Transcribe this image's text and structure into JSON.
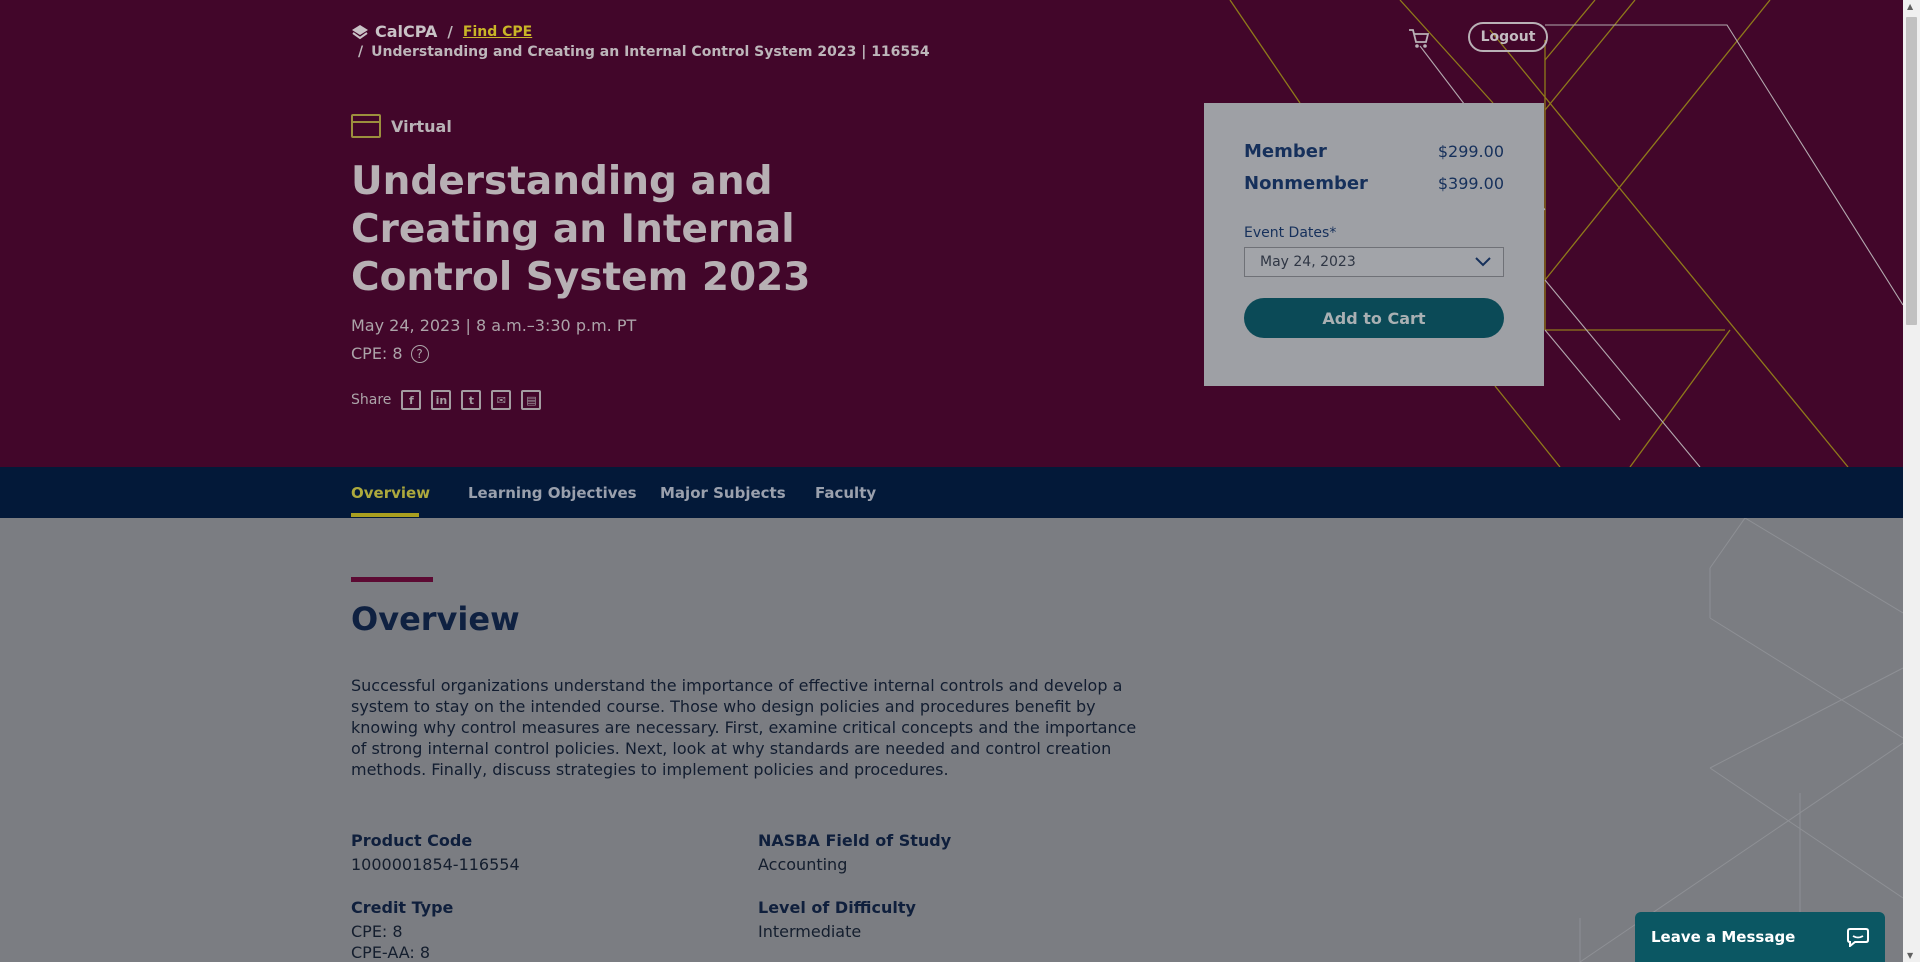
{
  "breadcrumb": {
    "brand": "CalCPA",
    "separator": "/",
    "find_cpe": "Find CPE",
    "current": "Understanding and Creating an Internal Control System 2023 | 116554"
  },
  "header": {
    "logout_label": "Logout",
    "cart_icon": "cart-icon"
  },
  "course": {
    "format": "Virtual",
    "title": "Understanding and Creating an Internal Control System 2023",
    "date_time": "May 24, 2023 | 8 a.m.–3:30 p.m. PT",
    "cpe": "CPE: 8",
    "share_label": "Share",
    "share_icons": [
      "facebook-icon",
      "linkedin-icon",
      "twitter-icon",
      "email-icon",
      "calendar-icon"
    ]
  },
  "pricing": {
    "member_label": "Member",
    "member_price": "$299.00",
    "nonmember_label": "Nonmember",
    "nonmember_price": "$399.00",
    "event_dates_label": "Event Dates*",
    "event_date_selected": "May 24, 2023",
    "add_to_cart_label": "Add to Cart"
  },
  "tabs": [
    {
      "label": "Overview",
      "active": true
    },
    {
      "label": "Learning Objectives",
      "active": false
    },
    {
      "label": "Major Subjects",
      "active": false
    },
    {
      "label": "Faculty",
      "active": false
    }
  ],
  "overview": {
    "heading": "Overview",
    "text": "Successful organizations understand the importance of effective internal controls and develop a system to stay on the intended course. Those who design policies and procedures benefit by knowing why control measures are necessary. First, examine critical concepts and the importance of strong internal control policies. Next, look at why standards are needed and control creation methods. Finally, discuss strategies to implement policies and procedures.",
    "facts": {
      "product_code_label": "Product Code",
      "product_code_value": "1000001854-116554",
      "nasba_label": "NASBA Field of Study",
      "nasba_value": "Accounting",
      "credit_type_label": "Credit Type",
      "credit_type_line1": "CPE: 8",
      "credit_type_line2": "CPE-AA: 8",
      "difficulty_label": "Level of Difficulty",
      "difficulty_value": "Intermediate"
    }
  },
  "chat": {
    "label": "Leave a Message"
  },
  "colors": {
    "hero_bg": "#42062a",
    "nav_bg": "#031939",
    "accent_gold": "#a99f20",
    "button_teal": "#0b4a57",
    "overlay_bg": "#7b7d82"
  }
}
